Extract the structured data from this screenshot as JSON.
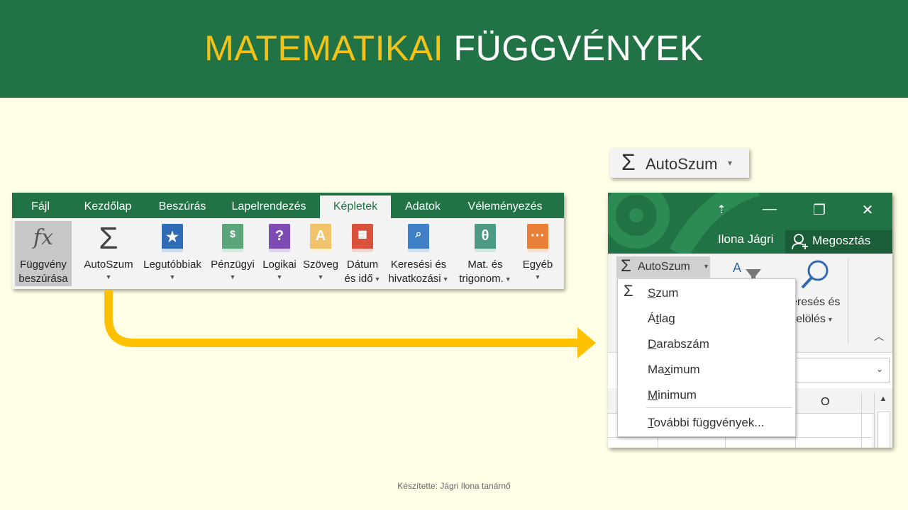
{
  "slide": {
    "title_part1": "MATEMATIKAI",
    "title_part2": "FÜGGVÉNYEK",
    "footer": "Készítette: Jágri Ilona tanárnő"
  },
  "ribbon": {
    "tabs": [
      "Fájl",
      "Kezdőlap",
      "Beszúrás",
      "Lapelrendezés",
      "Képletek",
      "Adatok",
      "Véleményezés"
    ],
    "active_tab": "Képletek",
    "buttons": {
      "insert_function": {
        "line1": "Függvény",
        "line2": "beszúrása",
        "icon": "fx"
      },
      "autosum": {
        "line1": "AutoSzum",
        "icon": "Σ"
      },
      "recent": {
        "line1": "Legutóbbiak",
        "icon": "★"
      },
      "financial": {
        "line1": "Pénzügyi"
      },
      "logical": {
        "line1": "Logikai",
        "icon": "?"
      },
      "text": {
        "line1": "Szöveg",
        "icon": "A"
      },
      "datetime": {
        "line1": "Dátum",
        "line2": "és idő"
      },
      "lookup": {
        "line1": "Keresési és",
        "line2": "hivatkozási"
      },
      "math": {
        "line1": "Mat. és",
        "line2": "trigonom.",
        "icon": "θ"
      },
      "more": {
        "line1": "Egyéb",
        "icon": "···"
      }
    },
    "colors": {
      "excel_green": "#217346",
      "recent_blue": "#2e6bb4",
      "financial_green": "#5aa57a",
      "logical_purple": "#7e4bb5",
      "text_orange": "#f1c36a",
      "datetime_red": "#d9533c",
      "lookup_blue": "#3f7fc6",
      "math_teal": "#4c9a86",
      "more_orange": "#e8803a"
    }
  },
  "chip": {
    "sigma": "Σ",
    "label": "AutoSzum",
    "caret": "▾"
  },
  "window": {
    "controls": {
      "ribbon_display": "⇡",
      "minimize": "—",
      "restore": "❐",
      "close": "✕"
    },
    "user": "Ilona Jágri",
    "share": "Megosztás",
    "autosum_label": "AutoSzum",
    "find_select_line1": "eresés és",
    "find_select_line2": "ijelölés",
    "column_label": "O",
    "menu": {
      "sum": {
        "pre": "",
        "u": "S",
        "post": "zum"
      },
      "average": {
        "pre": "Á",
        "u": "t",
        "post": "lag"
      },
      "count": {
        "pre": "",
        "u": "D",
        "post": "arabszám"
      },
      "max": {
        "pre": "Ma",
        "u": "x",
        "post": "imum"
      },
      "min": {
        "pre": "",
        "u": "M",
        "post": "inimum"
      },
      "more": {
        "pre": "",
        "u": "T",
        "post": "ovábbi függvények..."
      }
    }
  }
}
